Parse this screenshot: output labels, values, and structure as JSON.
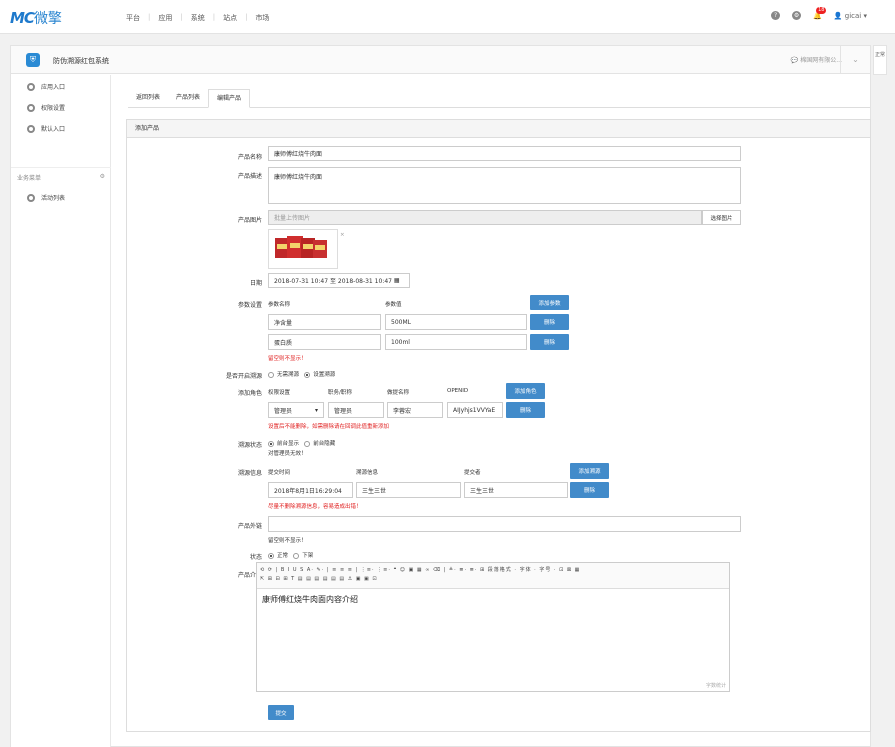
{
  "topbar": {
    "logo_main": "MC",
    "logo_cn": "微擎",
    "nav": [
      "平台",
      "应用",
      "系统",
      "站点",
      "市场"
    ],
    "help_icon": "help-icon",
    "notice_count": "18",
    "user": "gicai"
  },
  "app": {
    "title": "防伪溯源红包系统",
    "account": "棉国网有限公..."
  },
  "sidetab": "正常",
  "sidebar": {
    "items": [
      {
        "label": "应用入口"
      },
      {
        "label": "权限设置"
      },
      {
        "label": "默认入口"
      }
    ],
    "group": "业务菜单",
    "group_items": [
      {
        "label": "活动列表"
      }
    ]
  },
  "tabs": [
    "返回列表",
    "产品列表",
    "编辑产品"
  ],
  "panel_title": "添加产品",
  "form": {
    "name_label": "产品名称",
    "name_value": "康师傅红烧牛肉面",
    "desc_label": "产品描述",
    "desc_value": "康师傅红烧牛肉面",
    "image_label": "产品图片",
    "image_placeholder": "批量上传图片",
    "image_button": "选择图片",
    "date_label": "日期",
    "date_value": "2018-07-31 10:47 至 2018-08-31 10:47",
    "params_label": "参数设置",
    "param_name_head": "参数名称",
    "param_value_head": "参数值",
    "add_param": "添加参数",
    "params": [
      {
        "name": "净含量",
        "value": "500ML",
        "delete": "删除"
      },
      {
        "name": "蛋白质",
        "value": "100ml",
        "delete": "删除"
      }
    ],
    "params_hint": "留空则不显示！",
    "trace_open_label": "是否开启溯源",
    "trace_open_options": [
      "无需溯源",
      "设置溯源"
    ],
    "role_label": "添加角色",
    "role_heads": [
      "权限设置",
      "职务/职称",
      "做提名称",
      "OPENID"
    ],
    "add_role": "添加角色",
    "role_row": {
      "perm": "管理员",
      "title": "管理员",
      "name": "李蓉宏",
      "openid": "AIJyhjs1VVYaE",
      "delete": "删除"
    },
    "role_hint": "设置后不能删除，如需删除请在回调此值重新添加",
    "trace_state_label": "溯源状态",
    "trace_state_options": [
      "前台显示",
      "前台隐藏"
    ],
    "trace_state_hint": "对管理员无效！",
    "trace_info_label": "溯源信息",
    "trace_heads": [
      "提交时间",
      "溯源信息",
      "提交者"
    ],
    "add_trace": "添加溯源",
    "trace_row": {
      "time": "2018年8月1日16:29:04",
      "info": "三生三世",
      "submitter": "三生三世",
      "delete": "删除"
    },
    "trace_hint": "尽量不删除溯源信息，容易造成出错！",
    "link_label": "产品外链",
    "link_hint": "留空则不显示！",
    "status_label": "状态",
    "status_options": [
      "正常",
      "下架"
    ],
    "intro_label": "产品介绍",
    "intro_content": "康师傅红烧牛肉面内容介绍",
    "toolbar_row1": "⟲ ⟳ | B I U S A· ✎· | ≡ ≡ ≡ | ⋮≡· ⋮≡· ❝ ☺ ▣ ▦ ∞ ⌫ | ≜· ≣· ≣· ⊞ 段落格式 · 字体 · 字号 · ⊡ ⊠ ▦",
    "toolbar_row2": "⇱ ⊞ ⊟ ⊞ T ▤ ▤ ▤ ▤ ▤ ▤ ⚓ ▣ ▣ ⊡",
    "word_count": "字数统计",
    "submit": "提交"
  }
}
